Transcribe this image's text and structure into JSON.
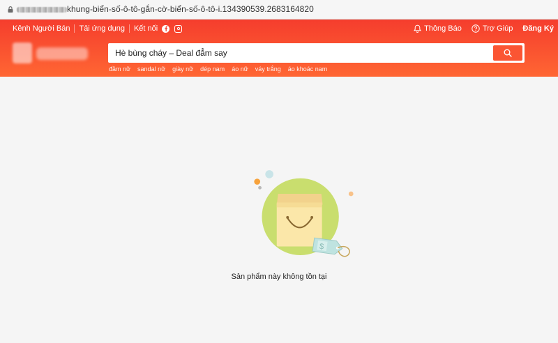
{
  "browser": {
    "url_visible": "khung-biển-số-ô-tô-gắn-cờ-biển-số-ô-tô-i.134390539.2683164820"
  },
  "header": {
    "nav_left": {
      "seller_center": "Kênh Người Bán",
      "download_app": "Tải ứng dụng",
      "connect": "Kết nối"
    },
    "nav_right": {
      "notifications": "Thông Báo",
      "help": "Trợ Giúp",
      "register": "Đăng Ký"
    },
    "search": {
      "placeholder": "Hè bùng cháy – Deal đẳm say"
    },
    "suggestions": [
      "đầm nữ",
      "sandal nữ",
      "giày nữ",
      "dép nam",
      "áo nữ",
      "váy trắng",
      "áo khoác nam"
    ],
    "colors": {
      "primary": "#f53d2d",
      "secondary": "#ff6633"
    }
  },
  "main": {
    "empty_message": "Sản phẩm này không tồn tại"
  }
}
